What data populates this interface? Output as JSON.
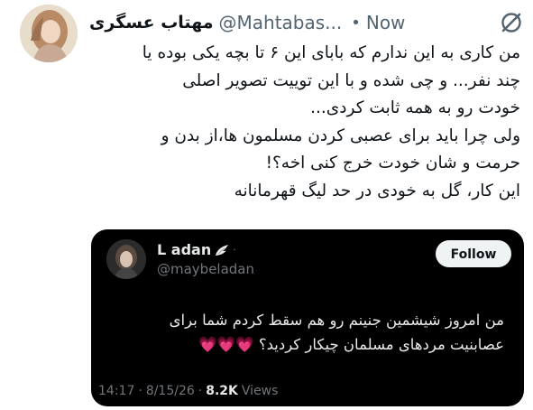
{
  "author": {
    "display_name": "مهتاب عسگری",
    "handle": "@Mahtabas...",
    "separator": "•",
    "time": "Now",
    "avatar_icon": "profile-photo",
    "grok_icon": "grok-slash-circle-icon"
  },
  "tweet": {
    "lines": [
      "من کاری به این ندارم که بابای این ۶ تا بچه یکی بوده یا",
      "چند نفر... و چی شده و با این توییت تصویر اصلی",
      "خودت رو به همه ثابت کردی...",
      "ولی چرا باید برای عصبی کردن مسلمون ها،از بدن و",
      "حرمت و شان خودت خرج کنی اخه؟!",
      "این کار، گل به خودی در حد لیگ قهرمانانه"
    ]
  },
  "quote": {
    "display_name": "L adan",
    "wing_icon": "white-wing-emoji",
    "dot": "·",
    "handle": "@maybeladan",
    "follow_label": "Follow",
    "lines": [
      "من امروز شیشمین جنینم رو هم سقط کردم شما برای",
      "عصابنیت مردهای مسلمان چیکار کردید؟ 💗💗💗"
    ],
    "time": "14:17",
    "separator": "·",
    "date": "8/15/26",
    "separator2": "·",
    "views_count": "8.2K",
    "views_label": "Views"
  },
  "colors": {
    "background": "#ffffff",
    "text_primary": "#0f1419",
    "text_secondary": "#536471",
    "quote_background": "#000000",
    "quote_text": "#e7e9ea",
    "quote_secondary": "#71767b",
    "follow_button_bg": "#eff3f4"
  }
}
